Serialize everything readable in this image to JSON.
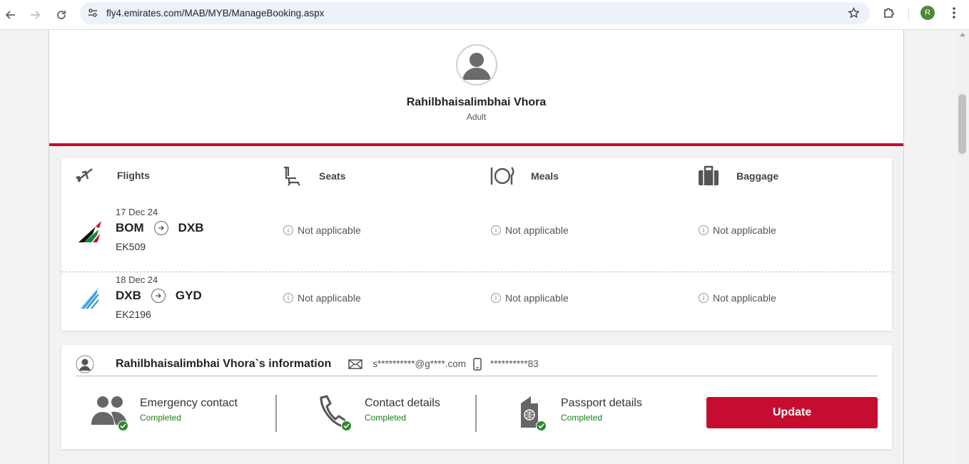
{
  "browser": {
    "url": "fly4.emirates.com/MAB/MYB/ManageBooking.aspx",
    "profile_initial": "R"
  },
  "passenger": {
    "name": "Rahilbhaisalimbhai Vhora",
    "type": "Adult"
  },
  "columns": {
    "flights": "Flights",
    "seats": "Seats",
    "meals": "Meals",
    "baggage": "Baggage"
  },
  "flights": [
    {
      "date": "17 Dec 24",
      "from": "BOM",
      "to": "DXB",
      "number": "EK509",
      "seats": "Not applicable",
      "meals": "Not applicable",
      "baggage": "Not applicable",
      "tail_icon": "emirates-tail-icon"
    },
    {
      "date": "18 Dec 24",
      "from": "DXB",
      "to": "GYD",
      "number": "EK2196",
      "seats": "Not applicable",
      "meals": "Not applicable",
      "baggage": "Not applicable",
      "tail_icon": "flydubai-tail-icon"
    }
  ],
  "info": {
    "title": "Rahilbhaisalimbhai Vhora`s information",
    "email": "s**********@g****.com",
    "phone": "**********83",
    "items": [
      {
        "label": "Emergency contact",
        "status": "Completed"
      },
      {
        "label": "Contact details",
        "status": "Completed"
      },
      {
        "label": "Passport details",
        "status": "Completed"
      }
    ],
    "update_label": "Update"
  },
  "colors": {
    "accent": "#c60c30",
    "completed": "#1a7d1a"
  }
}
